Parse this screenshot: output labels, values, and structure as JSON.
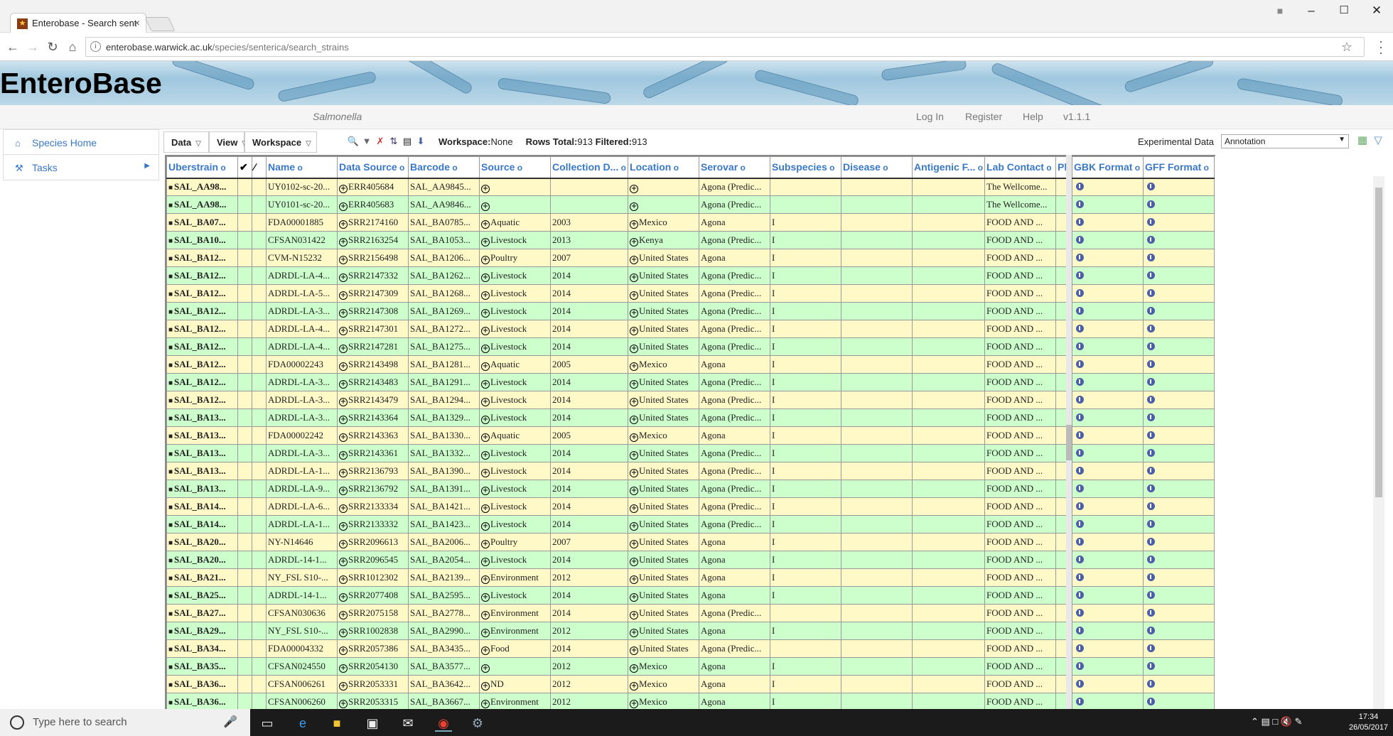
{
  "browser": {
    "tab_title": "Enterobase - Search sent",
    "tab_close": "×",
    "url_host": "enterobase.warwick.ac.uk",
    "url_path": "/species/senterica/search_strains"
  },
  "site": {
    "title": "EnteroBase",
    "species": "Salmonella",
    "nav": [
      "Log In",
      "Register",
      "Help",
      "v1.1.1"
    ]
  },
  "sidebar": {
    "items": [
      {
        "label": "Species Home",
        "icon": "home-icon"
      },
      {
        "label": "Tasks",
        "icon": "wrench-icon"
      }
    ]
  },
  "toolbar": {
    "data_label": "Data",
    "view_label": "View",
    "workspace_label": "Workspace",
    "workspace_key": "Workspace:",
    "workspace_value": "None",
    "rows_total_key": "Rows Total:",
    "rows_total_value": "913",
    "filtered_key": "Filtered:",
    "filtered_value": "913",
    "experimental_label": "Experimental Data",
    "experimental_value": "Annotation"
  },
  "table": {
    "columns": [
      "Uberstrain",
      "",
      "",
      "Name",
      "Data Source",
      "Barcode",
      "Source",
      "Collection D...",
      "Location",
      "Serovar",
      "Subspecies",
      "Disease",
      "Antigenic F...",
      "Lab Contact",
      "Ph"
    ],
    "exp_columns": [
      "GBK Format",
      "GFF Format"
    ],
    "rows": [
      [
        "SAL_AA98...",
        "UY0102-sc-20...",
        "ERR405684",
        "SAL_AA9845...",
        "",
        "",
        "",
        "Agona (Predic...",
        "",
        "The Wellcome..."
      ],
      [
        "SAL_AA98...",
        "UY0101-sc-20...",
        "ERR405683",
        "SAL_AA9846...",
        "",
        "",
        "",
        "Agona (Predic...",
        "",
        "The Wellcome..."
      ],
      [
        "SAL_BA07...",
        "FDA00001885",
        "SRR2174160",
        "SAL_BA0785...",
        "Aquatic",
        "2003",
        "Mexico",
        "Agona",
        "I",
        "FOOD AND ..."
      ],
      [
        "SAL_BA10...",
        "CFSAN031422",
        "SRR2163254",
        "SAL_BA1053...",
        "Livestock",
        "2013",
        "Kenya",
        "Agona (Predic...",
        "I",
        "FOOD AND ..."
      ],
      [
        "SAL_BA12...",
        "CVM-N15232",
        "SRR2156498",
        "SAL_BA1206...",
        "Poultry",
        "2007",
        "United States",
        "Agona",
        "I",
        "FOOD AND ..."
      ],
      [
        "SAL_BA12...",
        "ADRDL-LA-4...",
        "SRR2147332",
        "SAL_BA1262...",
        "Livestock",
        "2014",
        "United States",
        "Agona (Predic...",
        "I",
        "FOOD AND ..."
      ],
      [
        "SAL_BA12...",
        "ADRDL-LA-5...",
        "SRR2147309",
        "SAL_BA1268...",
        "Livestock",
        "2014",
        "United States",
        "Agona (Predic...",
        "I",
        "FOOD AND ..."
      ],
      [
        "SAL_BA12...",
        "ADRDL-LA-3...",
        "SRR2147308",
        "SAL_BA1269...",
        "Livestock",
        "2014",
        "United States",
        "Agona (Predic...",
        "I",
        "FOOD AND ..."
      ],
      [
        "SAL_BA12...",
        "ADRDL-LA-4...",
        "SRR2147301",
        "SAL_BA1272...",
        "Livestock",
        "2014",
        "United States",
        "Agona (Predic...",
        "I",
        "FOOD AND ..."
      ],
      [
        "SAL_BA12...",
        "ADRDL-LA-4...",
        "SRR2147281",
        "SAL_BA1275...",
        "Livestock",
        "2014",
        "United States",
        "Agona (Predic...",
        "I",
        "FOOD AND ..."
      ],
      [
        "SAL_BA12...",
        "FDA00002243",
        "SRR2143498",
        "SAL_BA1281...",
        "Aquatic",
        "2005",
        "Mexico",
        "Agona",
        "I",
        "FOOD AND ..."
      ],
      [
        "SAL_BA12...",
        "ADRDL-LA-3...",
        "SRR2143483",
        "SAL_BA1291...",
        "Livestock",
        "2014",
        "United States",
        "Agona (Predic...",
        "I",
        "FOOD AND ..."
      ],
      [
        "SAL_BA12...",
        "ADRDL-LA-3...",
        "SRR2143479",
        "SAL_BA1294...",
        "Livestock",
        "2014",
        "United States",
        "Agona (Predic...",
        "I",
        "FOOD AND ..."
      ],
      [
        "SAL_BA13...",
        "ADRDL-LA-3...",
        "SRR2143364",
        "SAL_BA1329...",
        "Livestock",
        "2014",
        "United States",
        "Agona (Predic...",
        "I",
        "FOOD AND ..."
      ],
      [
        "SAL_BA13...",
        "FDA00002242",
        "SRR2143363",
        "SAL_BA1330...",
        "Aquatic",
        "2005",
        "Mexico",
        "Agona",
        "I",
        "FOOD AND ..."
      ],
      [
        "SAL_BA13...",
        "ADRDL-LA-3...",
        "SRR2143361",
        "SAL_BA1332...",
        "Livestock",
        "2014",
        "United States",
        "Agona (Predic...",
        "I",
        "FOOD AND ..."
      ],
      [
        "SAL_BA13...",
        "ADRDL-LA-1...",
        "SRR2136793",
        "SAL_BA1390...",
        "Livestock",
        "2014",
        "United States",
        "Agona (Predic...",
        "I",
        "FOOD AND ..."
      ],
      [
        "SAL_BA13...",
        "ADRDL-LA-9...",
        "SRR2136792",
        "SAL_BA1391...",
        "Livestock",
        "2014",
        "United States",
        "Agona (Predic...",
        "I",
        "FOOD AND ..."
      ],
      [
        "SAL_BA14...",
        "ADRDL-LA-6...",
        "SRR2133334",
        "SAL_BA1421...",
        "Livestock",
        "2014",
        "United States",
        "Agona (Predic...",
        "I",
        "FOOD AND ..."
      ],
      [
        "SAL_BA14...",
        "ADRDL-LA-1...",
        "SRR2133332",
        "SAL_BA1423...",
        "Livestock",
        "2014",
        "United States",
        "Agona (Predic...",
        "I",
        "FOOD AND ..."
      ],
      [
        "SAL_BA20...",
        "NY-N14646",
        "SRR2096613",
        "SAL_BA2006...",
        "Poultry",
        "2007",
        "United States",
        "Agona",
        "I",
        "FOOD AND ..."
      ],
      [
        "SAL_BA20...",
        "ADRDL-14-1...",
        "SRR2096545",
        "SAL_BA2054...",
        "Livestock",
        "2014",
        "United States",
        "Agona",
        "I",
        "FOOD AND ..."
      ],
      [
        "SAL_BA21...",
        "NY_FSL S10-...",
        "SRR1012302",
        "SAL_BA2139...",
        "Environment",
        "2012",
        "United States",
        "Agona",
        "I",
        "FOOD AND ..."
      ],
      [
        "SAL_BA25...",
        "ADRDL-14-1...",
        "SRR2077408",
        "SAL_BA2595...",
        "Livestock",
        "2014",
        "United States",
        "Agona",
        "I",
        "FOOD AND ..."
      ],
      [
        "SAL_BA27...",
        "CFSAN030636",
        "SRR2075158",
        "SAL_BA2778...",
        "Environment",
        "2014",
        "United States",
        "Agona (Predic...",
        "",
        "FOOD AND ..."
      ],
      [
        "SAL_BA29...",
        "NY_FSL S10-...",
        "SRR1002838",
        "SAL_BA2990...",
        "Environment",
        "2012",
        "United States",
        "Agona",
        "I",
        "FOOD AND ..."
      ],
      [
        "SAL_BA34...",
        "FDA00004332",
        "SRR2057386",
        "SAL_BA3435...",
        "Food",
        "2014",
        "United States",
        "Agona (Predic...",
        "",
        "FOOD AND ..."
      ],
      [
        "SAL_BA35...",
        "CFSAN024550",
        "SRR2054130",
        "SAL_BA3577...",
        "",
        "2012",
        "Mexico",
        "Agona",
        "I",
        "FOOD AND ..."
      ],
      [
        "SAL_BA36...",
        "CFSAN006261",
        "SRR2053331",
        "SAL_BA3642...",
        "ND",
        "2012",
        "Mexico",
        "Agona",
        "I",
        "FOOD AND ..."
      ],
      [
        "SAL_BA36...",
        "CFSAN006260",
        "SRR2053315",
        "SAL_BA3667...",
        "Environment",
        "2012",
        "Mexico",
        "Agona",
        "I",
        "FOOD AND ..."
      ]
    ]
  },
  "taskbar": {
    "search_placeholder": "Type here to search",
    "time": "17:34",
    "date": "26/05/2017"
  },
  "colors": {
    "row_yellow": "#fff9c8",
    "row_green": "#ccffcc",
    "link_blue": "#3a79c7"
  }
}
